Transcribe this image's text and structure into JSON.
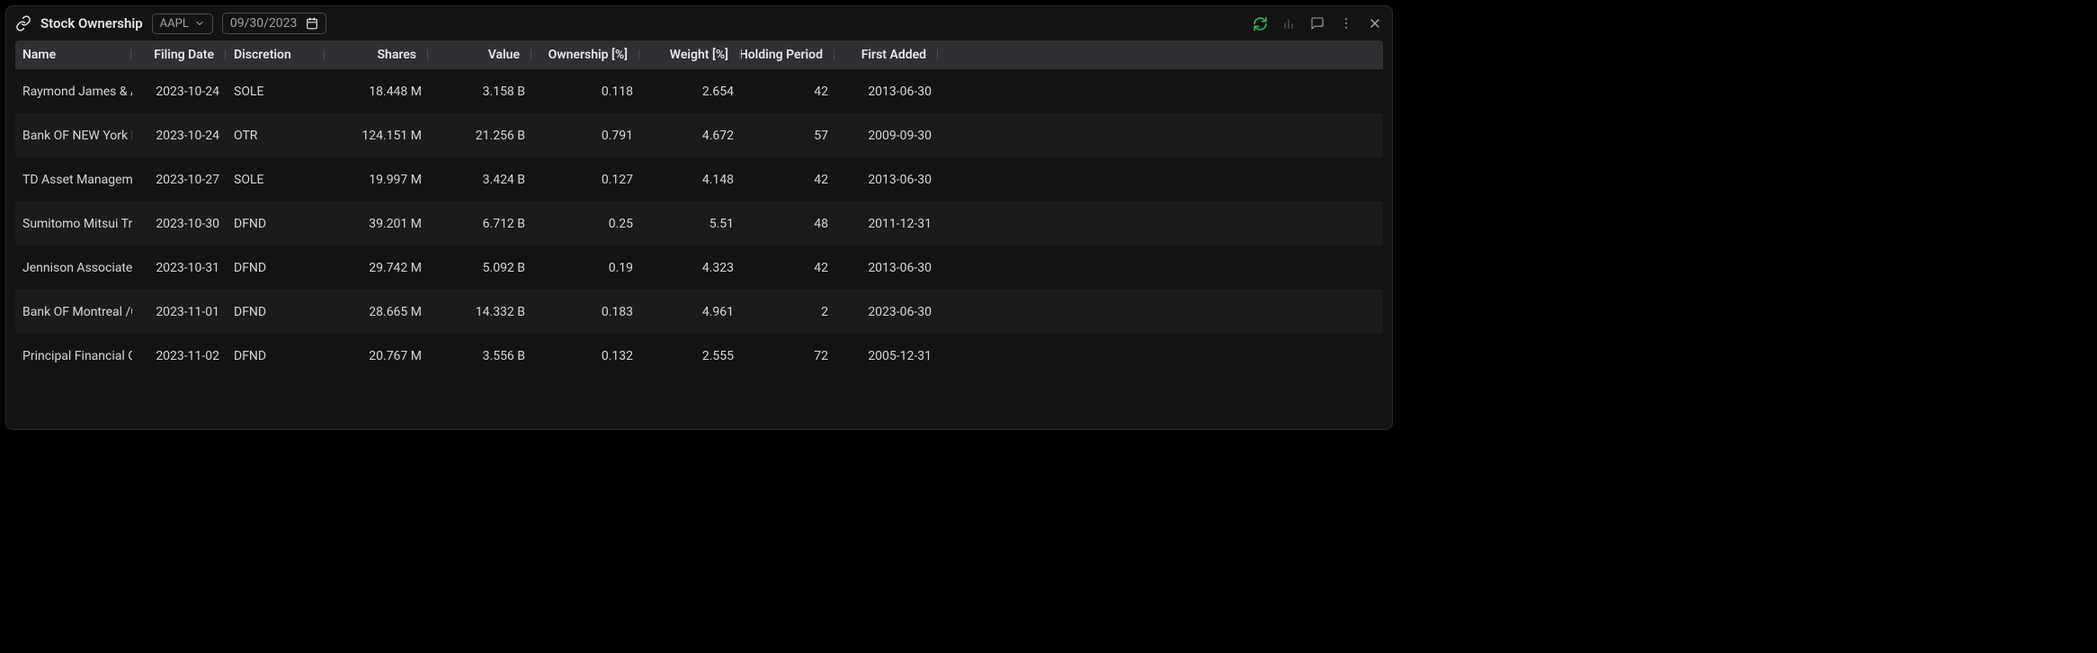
{
  "header": {
    "title": "Stock Ownership",
    "ticker": "AAPL",
    "date": "09/30/2023"
  },
  "columns": {
    "name": "Name",
    "filing_date": "Filing Date",
    "discretion": "Discretion",
    "shares": "Shares",
    "value": "Value",
    "ownership": "Ownership [%]",
    "weight": "Weight [%]",
    "holding_period": "Holding Period",
    "first_added": "First Added"
  },
  "rows": [
    {
      "name": "Raymond James & Associates",
      "filing_date": "2023-10-24",
      "discretion": "SOLE",
      "shares": "18.448 M",
      "value": "3.158 B",
      "ownership": "0.118",
      "weight": "2.654",
      "holding_period": "42",
      "first_added": "2013-06-30"
    },
    {
      "name": "Bank OF NEW York Mellon",
      "filing_date": "2023-10-24",
      "discretion": "OTR",
      "shares": "124.151 M",
      "value": "21.256 B",
      "ownership": "0.791",
      "weight": "4.672",
      "holding_period": "57",
      "first_added": "2009-09-30"
    },
    {
      "name": "TD Asset Management",
      "filing_date": "2023-10-27",
      "discretion": "SOLE",
      "shares": "19.997 M",
      "value": "3.424 B",
      "ownership": "0.127",
      "weight": "4.148",
      "holding_period": "42",
      "first_added": "2013-06-30"
    },
    {
      "name": "Sumitomo Mitsui Trust",
      "filing_date": "2023-10-30",
      "discretion": "DFND",
      "shares": "39.201 M",
      "value": "6.712 B",
      "ownership": "0.25",
      "weight": "5.51",
      "holding_period": "48",
      "first_added": "2011-12-31"
    },
    {
      "name": "Jennison Associates LLC",
      "filing_date": "2023-10-31",
      "discretion": "DFND",
      "shares": "29.742 M",
      "value": "5.092 B",
      "ownership": "0.19",
      "weight": "4.323",
      "holding_period": "42",
      "first_added": "2013-06-30"
    },
    {
      "name": "Bank OF Montreal /CAN/",
      "filing_date": "2023-11-01",
      "discretion": "DFND",
      "shares": "28.665 M",
      "value": "14.332 B",
      "ownership": "0.183",
      "weight": "4.961",
      "holding_period": "2",
      "first_added": "2023-06-30"
    },
    {
      "name": "Principal Financial Group",
      "filing_date": "2023-11-02",
      "discretion": "DFND",
      "shares": "20.767 M",
      "value": "3.556 B",
      "ownership": "0.132",
      "weight": "2.555",
      "holding_period": "72",
      "first_added": "2005-12-31"
    }
  ]
}
